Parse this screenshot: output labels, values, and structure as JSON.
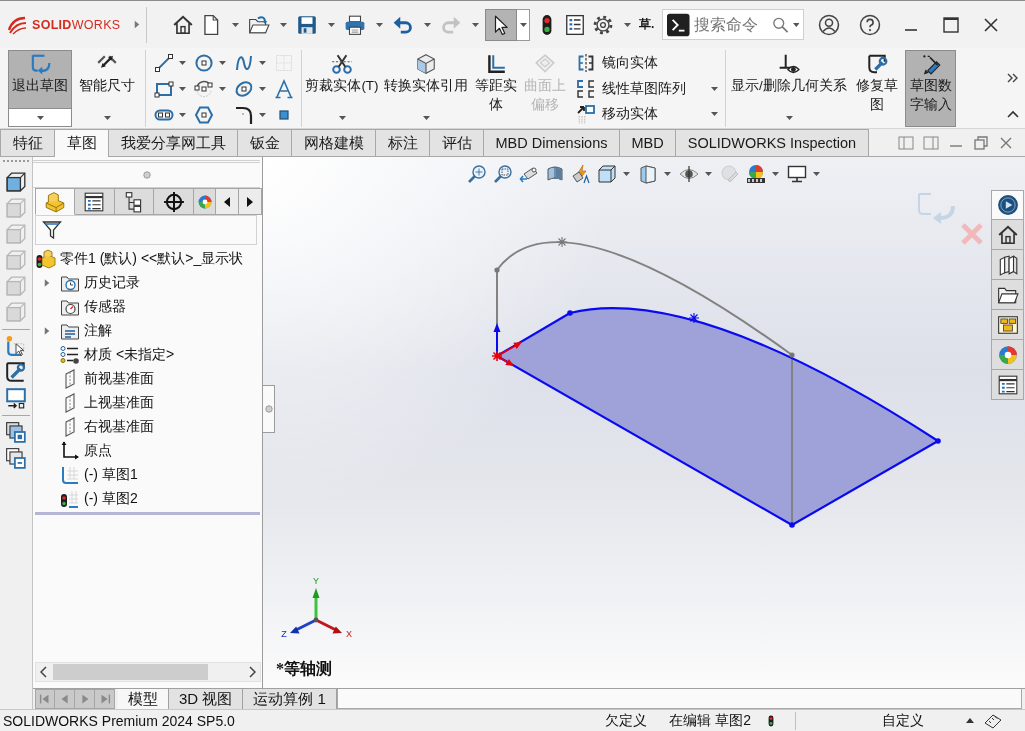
{
  "title_bar": {
    "logo": "**SOLID**WORKS",
    "quick_access": [
      {
        "dropdown": false,
        "disabled": false,
        "selected": false
      },
      {
        "dropdown": true,
        "disabled": false,
        "selected": false
      },
      {
        "dropdown": true,
        "disabled": false,
        "selected": false
      },
      {
        "dropdown": true,
        "disabled": false,
        "selected": false
      },
      {
        "dropdown": true,
        "disabled": false,
        "selected": false
      },
      {
        "dropdown": true,
        "disabled": false,
        "selected": false
      },
      {
        "dropdown": true,
        "disabled": true,
        "selected": false
      },
      {
        "dropdown": true,
        "disabled": false,
        "selected": true
      },
      {
        "dropdown": false,
        "disabled": false,
        "selected": false
      },
      {
        "dropdown": false,
        "disabled": false,
        "selected": false
      },
      {
        "dropdown": true,
        "disabled": false,
        "selected": false
      }
    ],
    "document_label": "草.",
    "search": {
      "placeholder": "搜索命令"
    }
  },
  "ribbon": {
    "groups": [
      {
        "commands": [
          {
            "label": "退出草图",
            "selected": true,
            "disabled": false,
            "dropdown": true
          },
          {
            "label": "智能尺寸",
            "selected": false,
            "disabled": false,
            "dropdown": true
          }
        ]
      },
      {
        "tools": [
          {
            "dropdown": true,
            "disabled": false
          },
          {
            "dropdown": true,
            "disabled": false
          },
          {
            "dropdown": true,
            "disabled": false
          },
          {
            "dropdown": false,
            "disabled": true
          },
          {
            "dropdown": true,
            "disabled": false
          },
          {
            "dropdown": true,
            "disabled": false
          },
          {
            "dropdown": true,
            "disabled": false
          },
          {
            "dropdown": false,
            "disabled": false
          },
          {
            "dropdown": true,
            "disabled": false
          },
          {
            "dropdown": false,
            "disabled": false
          },
          {
            "dropdown": true,
            "disabled": false
          },
          {
            "dropdown": false,
            "disabled": false
          }
        ]
      },
      {
        "commands": [
          {
            "label": "剪裁实体(T)",
            "selected": false,
            "disabled": false,
            "dropdown": true
          },
          {
            "label": "转换实体引用",
            "selected": false,
            "disabled": false,
            "dropdown": true
          },
          {
            "label": "等距实体",
            "selected": false,
            "disabled": false,
            "dropdown": false
          },
          {
            "label": "曲面上偏移",
            "selected": false,
            "disabled": true,
            "dropdown": false
          }
        ],
        "list": [
          {
            "label": "镜向实体",
            "dropdown": false
          },
          {
            "label": "线性草图阵列",
            "dropdown": true
          },
          {
            "label": "移动实体",
            "dropdown": true
          }
        ]
      },
      {
        "commands": [
          {
            "label": "显示/删除几何关系",
            "selected": false,
            "disabled": false,
            "dropdown": true
          },
          {
            "label": "修复草图",
            "selected": false,
            "disabled": false,
            "dropdown": false
          },
          {
            "label": "草图数字输入",
            "selected": true,
            "disabled": false,
            "dropdown": false
          }
        ]
      }
    ]
  },
  "tabs": [
    {
      "label": "特征",
      "selected": false
    },
    {
      "label": "草图",
      "selected": true
    },
    {
      "label": "我爱分享网工具",
      "selected": false
    },
    {
      "label": "钣金",
      "selected": false
    },
    {
      "label": "网格建模",
      "selected": false
    },
    {
      "label": "标注",
      "selected": false
    },
    {
      "label": "评估",
      "selected": false
    },
    {
      "label": "MBD Dimensions",
      "selected": false
    },
    {
      "label": "MBD",
      "selected": false
    },
    {
      "label": "SOLIDWORKS Inspection",
      "selected": false
    }
  ],
  "view_tools": [
    {
      "disabled": false
    },
    {
      "disabled": true
    },
    {
      "disabled": true
    },
    {
      "disabled": true
    },
    {
      "disabled": true
    },
    {
      "disabled": true
    },
    {
      "disabled": false
    },
    {
      "disabled": false
    },
    {
      "disabled": false
    },
    {
      "disabled": false
    },
    {
      "disabled": false
    }
  ],
  "feature_manager": {
    "tabs": [
      {
        "selected": true
      },
      {
        "selected": false
      },
      {
        "selected": false
      },
      {
        "selected": false
      },
      {
        "selected": false
      }
    ],
    "tree": {
      "label": "零件1 (默认) <<默认>_显示状",
      "kind": "part",
      "children": [
        {
          "label": "历史记录",
          "kind": "history",
          "expandable": true
        },
        {
          "label": "传感器",
          "kind": "sensors",
          "expandable": false
        },
        {
          "label": "注解",
          "kind": "annotations",
          "expandable": true
        },
        {
          "label": "材质 <未指定>",
          "kind": "material",
          "expandable": false
        },
        {
          "label": "前视基准面",
          "kind": "plane",
          "expandable": false
        },
        {
          "label": "上视基准面",
          "kind": "plane",
          "expandable": false
        },
        {
          "label": "右视基准面",
          "kind": "plane",
          "expandable": false
        },
        {
          "label": "原点",
          "kind": "origin",
          "expandable": false
        },
        {
          "label": "(-) 草图1",
          "kind": "sketch",
          "expandable": false
        },
        {
          "label": "(-) 草图2",
          "kind": "editsketch",
          "expandable": false
        }
      ]
    }
  },
  "viewport": {
    "toolbar": [
      {
        "dropdown": false,
        "disabled": false
      },
      {
        "dropdown": false,
        "disabled": false
      },
      {
        "dropdown": false,
        "disabled": false
      },
      {
        "dropdown": false,
        "disabled": false
      },
      {
        "dropdown": false,
        "disabled": false
      },
      {
        "dropdown": true,
        "disabled": false
      },
      {
        "dropdown": true,
        "disabled": false
      },
      {
        "dropdown": true,
        "disabled": false
      },
      {
        "dropdown": false,
        "disabled": true
      },
      {
        "dropdown": true,
        "disabled": false
      },
      {
        "dropdown": true,
        "disabled": false
      }
    ],
    "task_pane": [
      {
        "selected": true
      },
      {
        "selected": false
      },
      {
        "selected": false
      },
      {
        "selected": false
      },
      {
        "selected": false
      },
      {
        "selected": false
      },
      {
        "selected": false
      }
    ],
    "triad": {
      "x": "X",
      "y": "Y",
      "z": "Z"
    },
    "view_label": "*等轴测"
  },
  "bottom_tabs": [
    {
      "label": "模型",
      "selected": true
    },
    {
      "label": "3D 视图",
      "selected": false
    },
    {
      "label": "运动算例 1",
      "selected": false
    }
  ],
  "status_bar": {
    "product": "SOLIDWORKS Premium 2024 SP5.0",
    "definition": "欠定义",
    "editing": "在编辑 草图2",
    "units": "自定义"
  }
}
